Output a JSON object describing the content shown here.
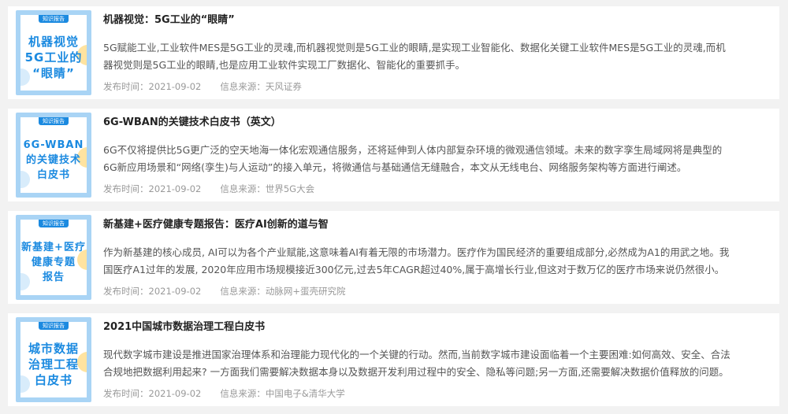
{
  "articles": [
    {
      "thumb_tag": "知识报告",
      "thumb_text": "机器视觉\n5G工业的\n“眼睛”",
      "title": "机器视觉：5G工业的“眼睛”",
      "summary": "5G赋能工业,工业软件MES是5G工业的灵魂,而机器视觉则是5G工业的眼睛,是实现工业智能化、数据化关键工业软件MES是5G工业的灵魂,而机器视觉则是5G工业的眼睛,也是应用工业软件实现工厂数据化、智能化的重要抓手。",
      "date": "发布时间：2021-09-02",
      "source": "信息来源：天风证券"
    },
    {
      "thumb_tag": "知识报告",
      "thumb_text": "6G-WBAN\n的关键技术\n白皮书",
      "title": "6G-WBAN的关键技术白皮书（英文）",
      "summary": "6G不仅将提供比5G更广泛的空天地海一体化宏观通信服务，还将延伸到人体内部复杂环境的微观通信领域。未来的数字孪生局域网将是典型的6G新应用场景和“网络(孪生)与人运动”的接入单元，将微通信与基础通信无缝融合，本文从无线电台、网络服务架构等方面进行阐述。",
      "date": "发布时间：2021-09-02",
      "source": "信息来源：世界5G大会"
    },
    {
      "thumb_tag": "知识报告",
      "thumb_text": "新基建+医疗\n健康专题\n报告",
      "title": "新基建+医疗健康专题报告：医疗AI创新的道与智",
      "summary": "作为新基建的核心成员, AI可以为各个产业赋能,这意味着AI有着无限的市场潜力。医疗作为国民经济的重要组成部分,必然成为A1的用武之地。我国医疗A1过年的发展, 2020年应用市场规模接近300亿元,过去5年CAGR超过40%,属于高增长行业,但这对于数万亿的医疗市场来说仍然很小。",
      "date": "发布时间：2021-09-02",
      "source": "信息来源：动脉网+蛋壳研究院"
    },
    {
      "thumb_tag": "知识报告",
      "thumb_text": "城市数据\n治理工程\n白皮书",
      "title": "2021中国城市数据治理工程白皮书",
      "summary": "现代数字城市建设是推进国家治理体系和治理能力现代化的一个关键的行动。然而,当前数字城市建设面临着一个主要困难:如何高效、安全、合法合规地把数据利用起来? 一方面我们需要解决数据本身以及数据开发利用过程中的安全、隐私等问题;另一方面,还需要解决数据价值释放的问题。",
      "date": "发布时间：2021-09-02",
      "source": "信息来源：中国电子&清华大学"
    }
  ],
  "colors": {
    "page_bg": "#f2f2f2",
    "card_bg": "#ffffff",
    "thumb_accent": "#1b8ae0",
    "title": "#222222",
    "summary": "#555555",
    "meta": "#999999"
  }
}
